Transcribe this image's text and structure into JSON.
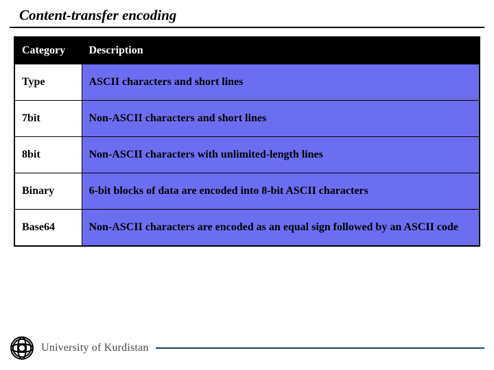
{
  "title": "Content-transfer encoding",
  "table": {
    "headers": {
      "category": "Category",
      "description": "Description"
    },
    "rows": [
      {
        "category": "Type",
        "description": " ASCII characters and short lines"
      },
      {
        "category": "7bit",
        "description": "Non-ASCII characters and short lines"
      },
      {
        "category": "8bit",
        "description": "Non-ASCII characters with unlimited-length lines"
      },
      {
        "category": "Binary",
        "description": "6-bit blocks of data are encoded into 8-bit ASCII characters"
      },
      {
        "category": "Base64",
        "description": "Non-ASCII characters are encoded as an equal sign followed by an ASCII code"
      }
    ]
  },
  "footer": {
    "university": "University of Kurdistan"
  }
}
